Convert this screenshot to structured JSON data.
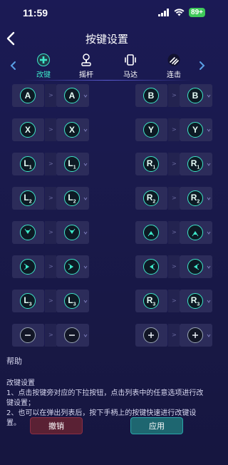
{
  "status": {
    "time": "11:59",
    "battery": "89+"
  },
  "header": {
    "title": "按键设置"
  },
  "tabs": [
    {
      "label": "改键",
      "icon": "gamepad-remap-icon",
      "active": true
    },
    {
      "label": "摇杆",
      "icon": "joystick-icon",
      "active": false
    },
    {
      "label": "马达",
      "icon": "vibration-motor-icon",
      "active": false
    },
    {
      "label": "连击",
      "icon": "turbo-icon",
      "active": false
    }
  ],
  "mappings": [
    {
      "src": "A",
      "dst": "A"
    },
    {
      "src": "B",
      "dst": "B"
    },
    {
      "src": "X",
      "dst": "X"
    },
    {
      "src": "Y",
      "dst": "Y"
    },
    {
      "src": "L1",
      "dst": "L1"
    },
    {
      "src": "R1",
      "dst": "R1"
    },
    {
      "src": "L2",
      "dst": "L2"
    },
    {
      "src": "R2",
      "dst": "R2"
    },
    {
      "src": "down",
      "dst": "down"
    },
    {
      "src": "up",
      "dst": "up"
    },
    {
      "src": "right",
      "dst": "right"
    },
    {
      "src": "left",
      "dst": "left"
    },
    {
      "src": "L3",
      "dst": "L3"
    },
    {
      "src": "R3",
      "dst": "R3"
    },
    {
      "src": "minus",
      "dst": "minus"
    },
    {
      "src": "plus",
      "dst": "plus"
    }
  ],
  "separator": ">",
  "help": {
    "title": "帮助",
    "subtitle": "改键设置",
    "line1": "1、点击按键旁对应的下拉按钮，点击列表中的任意选项进行改键设置；",
    "line2": "2、也可以在弹出列表后，按下手柄上的按键快速进行改键设置。"
  },
  "actions": {
    "cancel": "撤销",
    "apply": "应用"
  },
  "colors": {
    "accent": "#3de6c8",
    "cancel": "#5a2134",
    "apply": "#1e6670"
  }
}
